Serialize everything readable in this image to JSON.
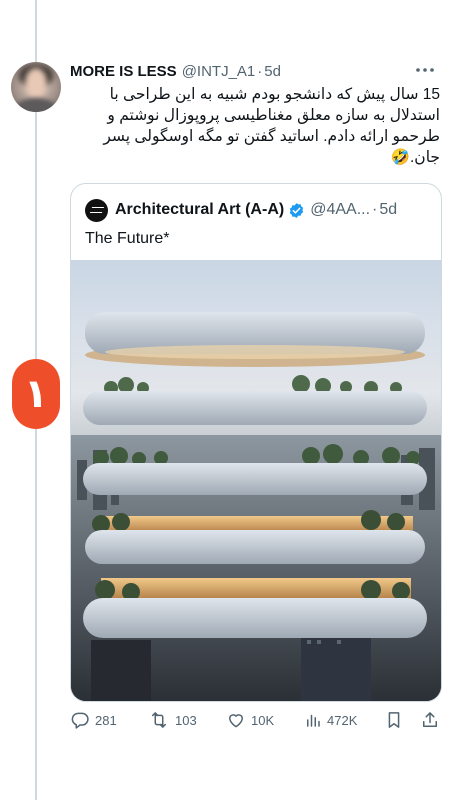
{
  "tweet": {
    "author": {
      "display_name": "MORE IS LESS",
      "handle": "@INTJ_A1",
      "separator": "·",
      "time": "5d"
    },
    "text": "15 سال پیش که دانشجو بودم شبیه به این طراحی با استدلال به سازه معلق مغناطیسی پروپوزال نوشتم و طرحمو ارائه دادم. اساتید گفتن تو مگه اوسگولی پسر جان.🤣",
    "side_badge": "۱",
    "quoted": {
      "display_name": "Architectural Art (A-A)",
      "handle": "@4AA...",
      "separator": "·",
      "time": "5d",
      "text": "The Future*"
    },
    "actions": {
      "replies": "281",
      "retweets": "103",
      "likes": "10K",
      "views": "472K"
    }
  },
  "icons": {
    "more": "more-horizontal-icon",
    "reply": "comment-icon",
    "retweet": "retweet-icon",
    "like": "heart-icon",
    "views": "bar-chart-icon",
    "bookmark": "bookmark-icon",
    "share": "share-icon",
    "verified": "verified-badge-icon"
  },
  "colors": {
    "text": "#0f1419",
    "muted": "#536471",
    "border": "#cfd9de",
    "verified": "#1d9bf0",
    "badge": "#ef4e2a"
  }
}
